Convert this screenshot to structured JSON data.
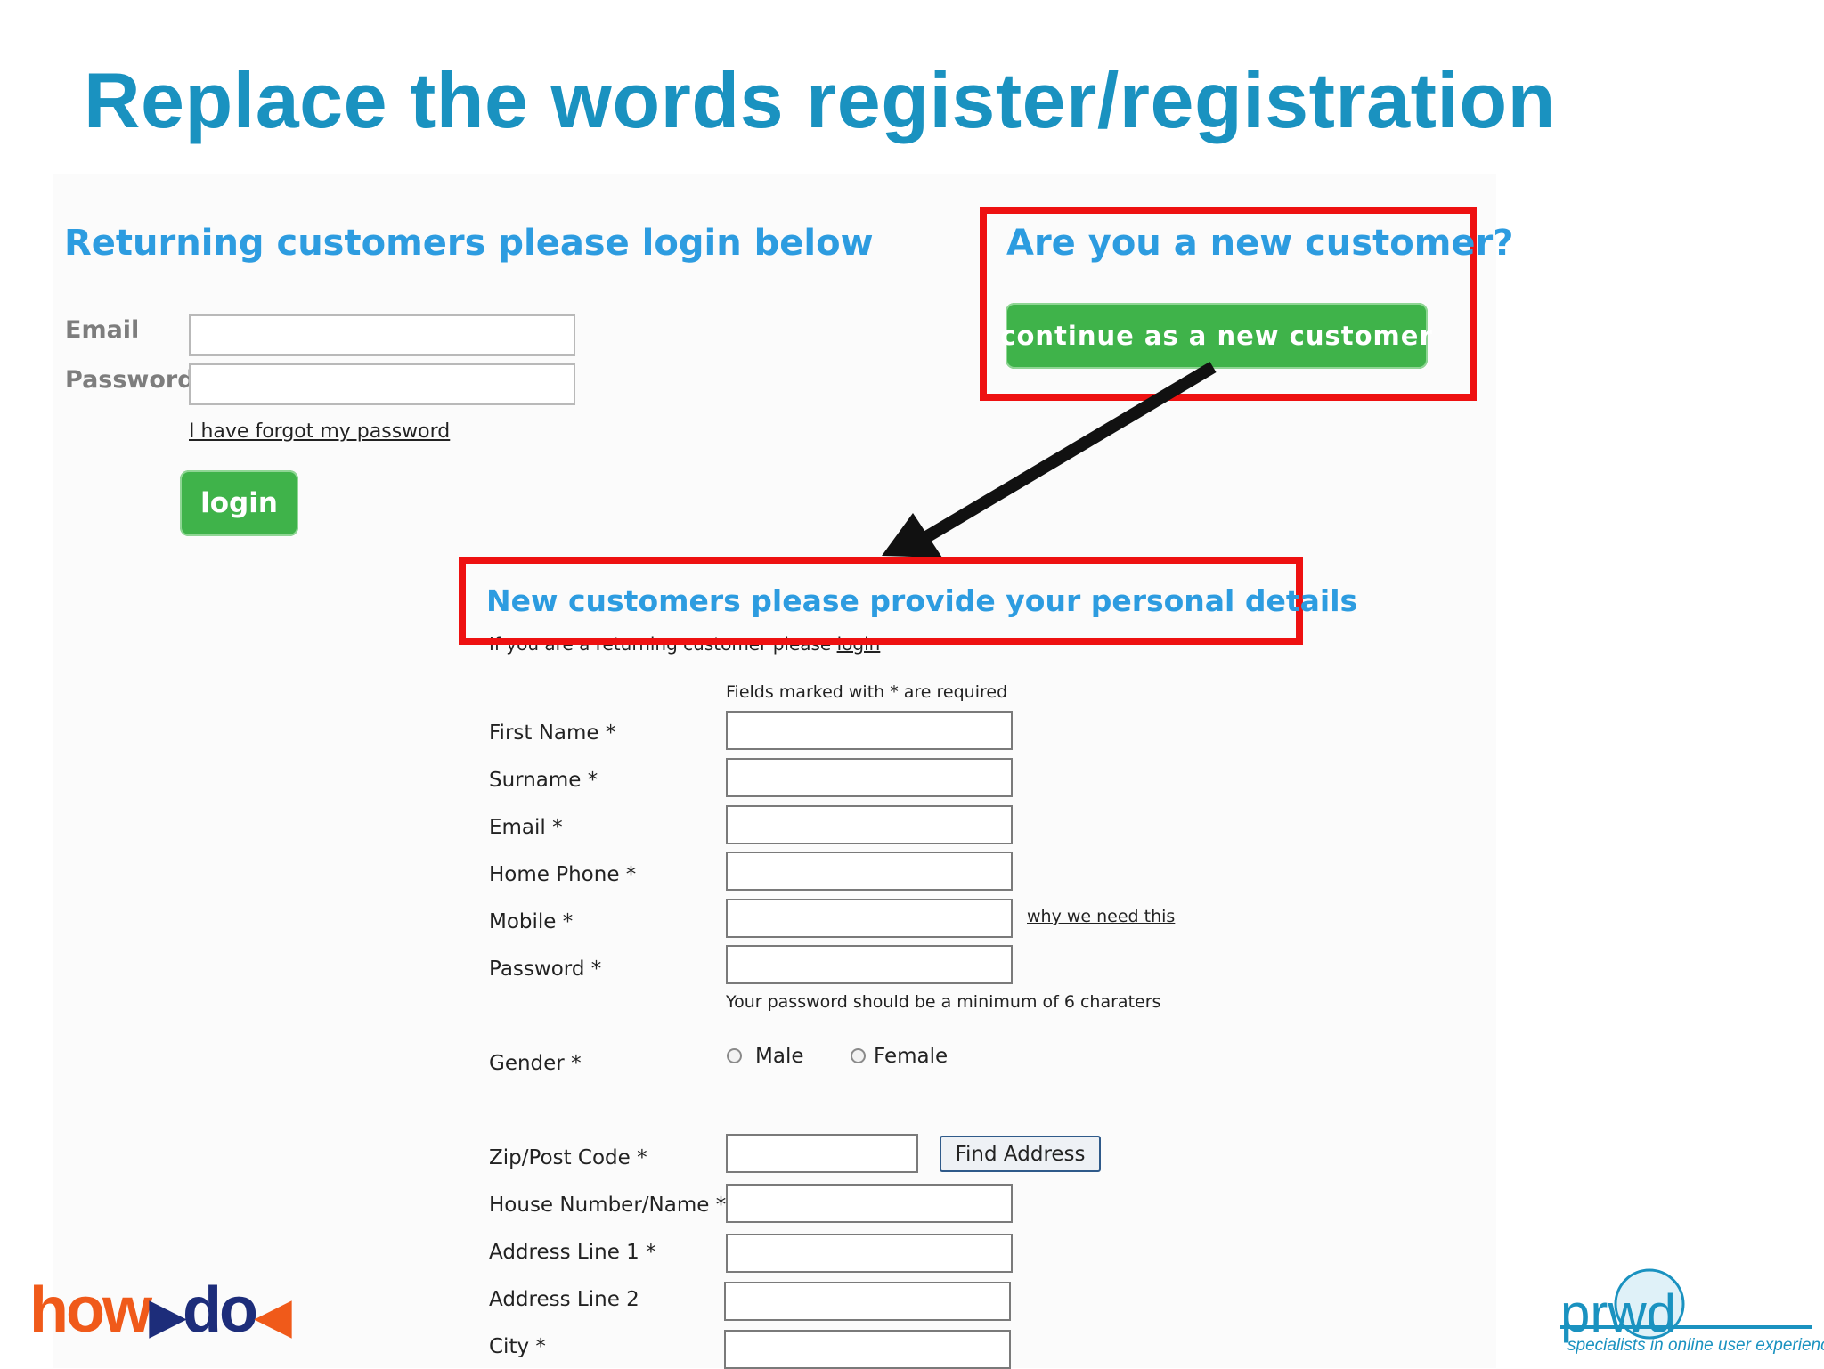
{
  "slide": {
    "title": "Replace the words register/registration"
  },
  "login": {
    "heading": "Returning customers please login below",
    "email_label": "Email",
    "password_label": "Password",
    "forgot_link": "I have forgot my password",
    "login_button": "login"
  },
  "new_customer": {
    "heading": "Are you a new customer?",
    "continue_button": "continue as a new customer"
  },
  "personal": {
    "heading": "New customers please provide your personal details",
    "returning_note": "If you are a returning customer please",
    "returning_link": "login",
    "required_note": "Fields marked with * are required",
    "fields": {
      "first_name": "First Name *",
      "surname": "Surname *",
      "email": "Email *",
      "home_phone": "Home Phone *",
      "mobile": "Mobile *",
      "password": "Password *",
      "gender": "Gender *",
      "zip": "Zip/Post Code *",
      "house": "House Number/Name *",
      "address1": "Address Line 1 *",
      "address2": "Address Line 2",
      "city": "City *"
    },
    "why_link": "why we need this",
    "password_hint": "Your password should be a minimum of 6 charaters",
    "gender_options": {
      "male": "Male",
      "female": "Female"
    },
    "find_address_button": "Find Address"
  },
  "logos": {
    "howdo": "howdo",
    "prwd": "prwd",
    "prwd_tagline": "specialists in online user experience"
  },
  "colors": {
    "title": "#1a92c0",
    "heading_blue": "#2d9ce0",
    "button_green": "#3fb34a",
    "highlight_red": "#ee1111"
  }
}
